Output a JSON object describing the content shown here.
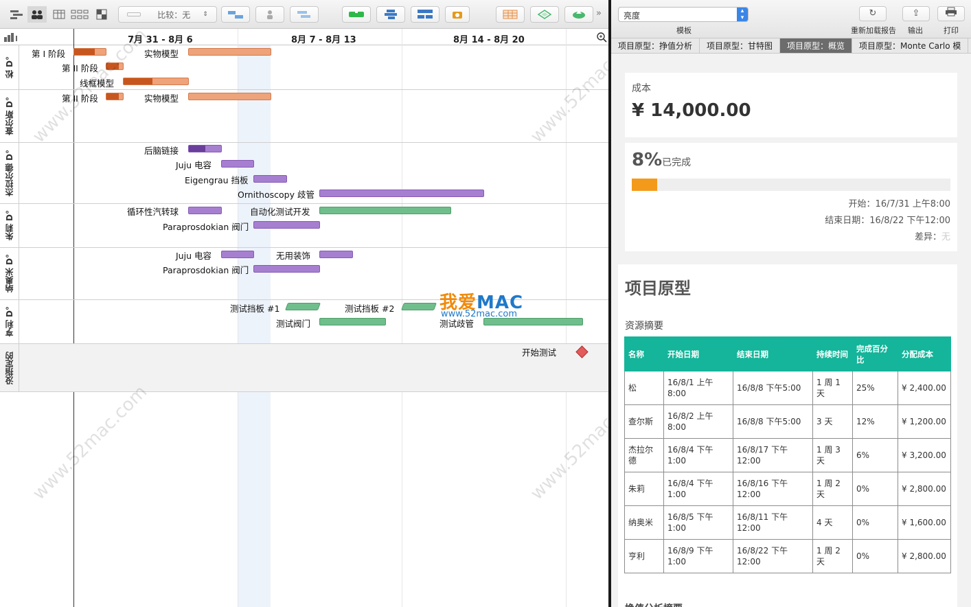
{
  "toolbar": {
    "compare_label": "比较：无"
  },
  "timeline": {
    "dates": [
      "7月 31 - 8月 6",
      "8月 7 - 8月 13",
      "8月 14 - 8月 20"
    ]
  },
  "resources": [
    {
      "name": "松 D°"
    },
    {
      "name": "查尔斯 D°"
    },
    {
      "name": "杰拉尔德 D°"
    },
    {
      "name": "朱莉 D°"
    },
    {
      "name": "纳奥米 D°"
    },
    {
      "name": "亨利 D°"
    },
    {
      "name": "没指定的"
    }
  ],
  "tasks": {
    "t1": "第 I 阶段",
    "t2": "实物模型",
    "t3": "第 II 阶段",
    "t4": "线框模型",
    "t5": "第 II 阶段",
    "t6": "实物模型",
    "t7": "后脑链接",
    "t8": "Juju 电容",
    "t9": "Eigengrau 挡板",
    "t10": "Ornithoscopy 歧管",
    "t11": "循环性汽转球",
    "t12": "自动化测试开发",
    "t13": "Paraprosdokian 阀门",
    "t14": "Juju 电容",
    "t15": "无用装饰",
    "t16": "Paraprosdokian 阀门",
    "t17": "测试挡板 #1",
    "t18": "测试挡板 #2",
    "t19": "测试阀门",
    "t20": "测试歧管",
    "t21": "开始测试"
  },
  "watermarks": {
    "site": "www.52mac.com",
    "logo_a": "我爱",
    "logo_b": "MAC",
    "logo_url": "www.52mac.com"
  },
  "right_toolbar": {
    "brightness": "亮度",
    "template": "模板",
    "reload": "重新加载报告",
    "export": "输出",
    "print": "打印"
  },
  "tabs": [
    "项目原型：挣值分析",
    "项目原型：甘特图",
    "项目原型：概览",
    "项目原型：Monte Carlo 模"
  ],
  "summary": {
    "cost_label": "成本",
    "cost_value": "¥ 14,000.00",
    "percent": "8%",
    "percent_suffix": "已完成",
    "progress": 0.08,
    "start": "开始：16/7/31 上午8:00",
    "end": "结束日期：16/8/22 下午12:00",
    "variance_label": "差异：",
    "variance_value": "无"
  },
  "project_title": "项目原型",
  "resource_summary_title": "资源摘要",
  "table": {
    "headers": [
      "名称",
      "开始日期",
      "结束日期",
      "持续时间",
      "完成百分比",
      "分配成本"
    ],
    "rows": [
      [
        "松",
        "16/8/1 上午 8:00",
        "16/8/8 下午5:00",
        "1 周 1 天",
        "25%",
        "¥ 2,400.00"
      ],
      [
        "查尔斯",
        "16/8/2 上午 8:00",
        "16/8/8 下午5:00",
        "3 天",
        "12%",
        "¥ 1,200.00"
      ],
      [
        "杰拉尔德",
        "16/8/4 下午 1:00",
        "16/8/17 下午 12:00",
        "1 周 3 天",
        "6%",
        "¥ 3,200.00"
      ],
      [
        "朱莉",
        "16/8/4 下午 1:00",
        "16/8/16 下午 12:00",
        "1 周 2 天",
        "0%",
        "¥ 2,800.00"
      ],
      [
        "纳奥米",
        "16/8/5 下午 1:00",
        "16/8/11 下午 12:00",
        "4 天",
        "0%",
        "¥ 1,600.00"
      ],
      [
        "亨利",
        "16/8/9 下午 1:00",
        "16/8/22 下午 12:00",
        "1 周 2 天",
        "0%",
        "¥ 2,800.00"
      ]
    ]
  },
  "bottom_cut_text": "挣值分析摘要"
}
